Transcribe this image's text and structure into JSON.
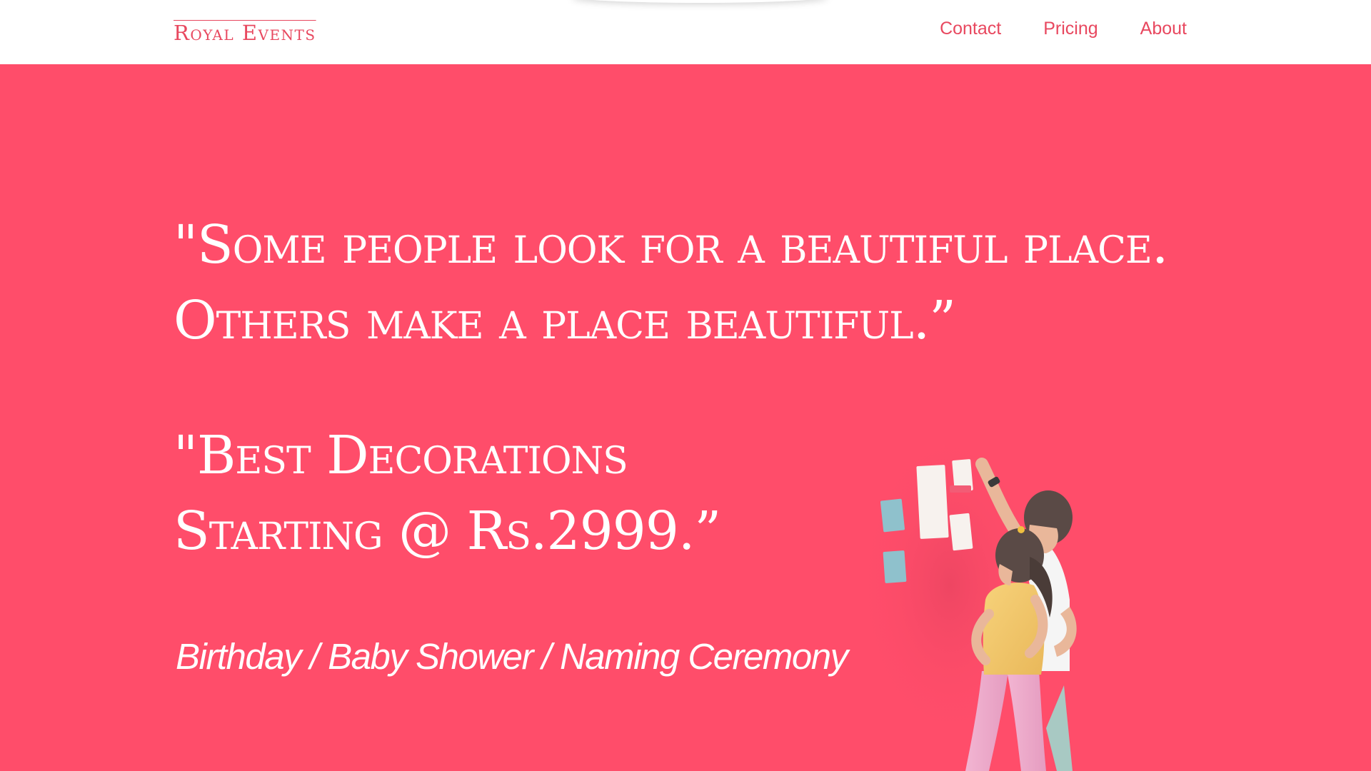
{
  "header": {
    "logo_text": "Royal Events",
    "nav": [
      {
        "label": "Contact"
      },
      {
        "label": "Pricing"
      },
      {
        "label": "About"
      }
    ]
  },
  "hero": {
    "quote_1": "\"Some people look for a beautiful place. Others make a place beautiful.”",
    "quote_2": "\"Best Decorations Starting @ Rs.2999.”",
    "tagline": "Birthday / Baby Shower / Naming Ceremony",
    "illustration": "two-people-arranging-sticky-notes-illustration"
  },
  "colors": {
    "brand": "#e8485f",
    "hero_background": "#ff4d6a",
    "header_background": "#ffffff",
    "hero_text": "#ffffff"
  }
}
